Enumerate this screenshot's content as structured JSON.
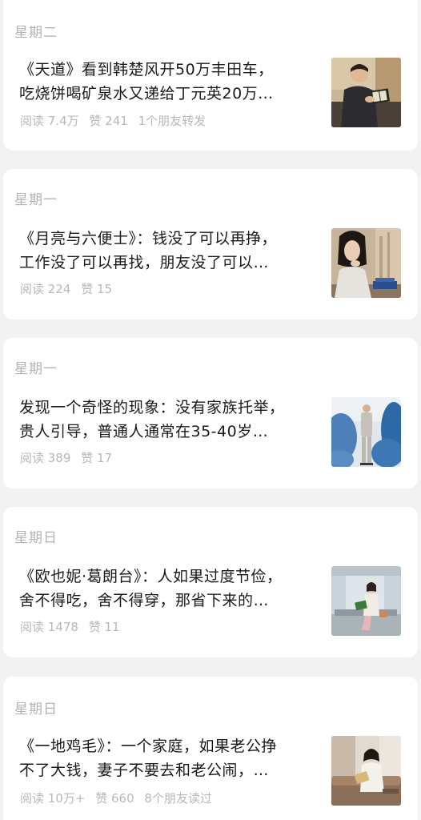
{
  "articles": [
    {
      "day": "星期二",
      "title_line1": "《天道》看到韩楚风开50万丰田车，",
      "title_line2": "吃烧饼喝矿泉水又递给丁元英20万…",
      "reads": "阅读 7.4万",
      "likes": "赞 241",
      "social": "1个朋友转发",
      "thumb": "man-reading-book-photo"
    },
    {
      "day": "星期一",
      "title_line1": "《月亮与六便士》：钱没了可以再挣，",
      "title_line2": "工作没了可以再找，朋友没了可以…",
      "reads": "阅读 224",
      "likes": "赞 15",
      "social": "",
      "thumb": "woman-with-book-photo"
    },
    {
      "day": "星期一",
      "title_line1": "发现一个奇怪的现象：没有家族托举，",
      "title_line2": "贵人引导，普通人通常在35-40岁…",
      "reads": "阅读 389",
      "likes": "赞 17",
      "social": "",
      "thumb": "man-under-tree-photo"
    },
    {
      "day": "星期日",
      "title_line1": "《欧也妮·葛朗台》：人如果过度节俭，",
      "title_line2": "舍不得吃，舍不得穿，那省下来的…",
      "reads": "阅读 1478",
      "likes": "赞 11",
      "social": "",
      "thumb": "woman-reading-station-photo"
    },
    {
      "day": "星期日",
      "title_line1": "《一地鸡毛》：一个家庭，如果老公挣",
      "title_line2": "不了大钱，妻子不要去和老公闹，…",
      "reads": "阅读 10万+",
      "likes": "赞 660",
      "social": "8个朋友读过",
      "thumb": "woman-reading-sofa-photo"
    }
  ]
}
